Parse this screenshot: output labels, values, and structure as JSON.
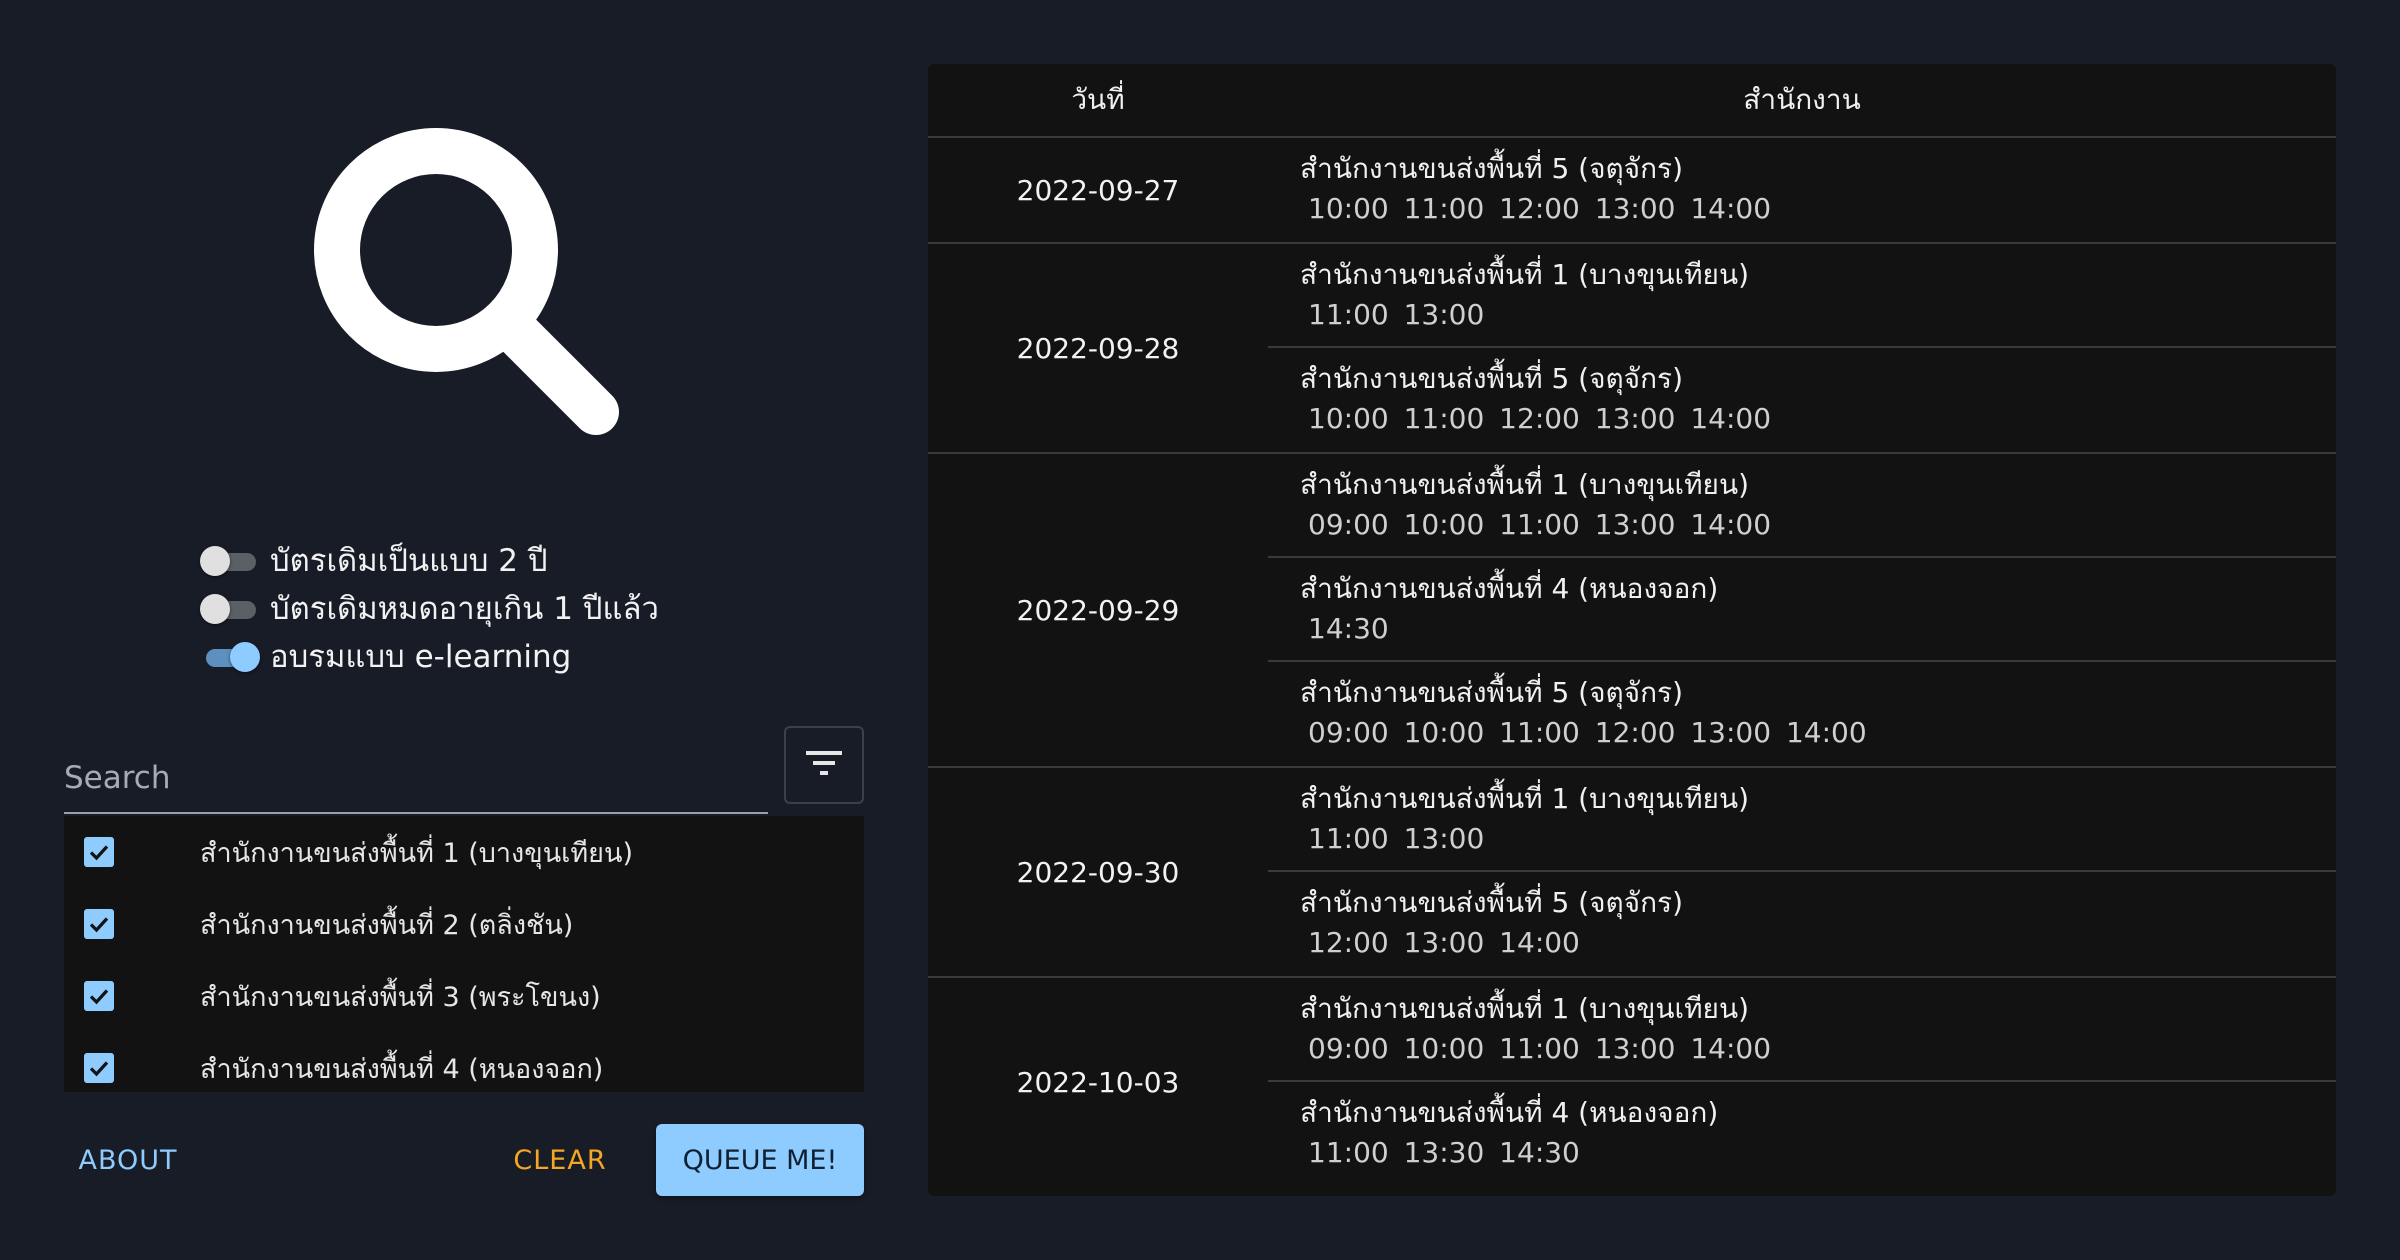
{
  "toggles": [
    {
      "label": "บัตรเดิมเป็นแบบ 2 ปี",
      "on": false
    },
    {
      "label": "บัตรเดิมหมดอายุเกิน 1 ปีแล้ว",
      "on": false
    },
    {
      "label": "อบรมแบบ e-learning",
      "on": true
    }
  ],
  "search": {
    "placeholder": "Search",
    "value": ""
  },
  "offices": [
    {
      "label": "สำนักงานขนส่งพื้นที่ 1 (บางขุนเทียน)",
      "checked": true
    },
    {
      "label": "สำนักงานขนส่งพื้นที่ 2 (ตลิ่งชัน)",
      "checked": true
    },
    {
      "label": "สำนักงานขนส่งพื้นที่ 3 (พระโขนง)",
      "checked": true
    },
    {
      "label": "สำนักงานขนส่งพื้นที่ 4 (หนองจอก)",
      "checked": true
    }
  ],
  "buttons": {
    "about": "ABOUT",
    "clear": "CLEAR",
    "queue": "QUEUE ME!"
  },
  "colors": {
    "accent": "#8ecbff",
    "clear": "#f5a623",
    "background": "#181c27",
    "panel": "#121212"
  },
  "table": {
    "headers": {
      "date": "วันที่",
      "office": "สำนักงาน"
    },
    "rows": [
      {
        "date": "2022-09-27",
        "entries": [
          {
            "office": "สำนักงานขนส่งพื้นที่ 5 (จตุจักร)",
            "times": "10:00  11:00  12:00  13:00  14:00"
          }
        ]
      },
      {
        "date": "2022-09-28",
        "entries": [
          {
            "office": "สำนักงานขนส่งพื้นที่ 1 (บางขุนเทียน)",
            "times": "11:00  13:00"
          },
          {
            "office": "สำนักงานขนส่งพื้นที่ 5 (จตุจักร)",
            "times": "10:00  11:00  12:00  13:00  14:00"
          }
        ]
      },
      {
        "date": "2022-09-29",
        "entries": [
          {
            "office": "สำนักงานขนส่งพื้นที่ 1 (บางขุนเทียน)",
            "times": "09:00  10:00  11:00  13:00  14:00"
          },
          {
            "office": "สำนักงานขนส่งพื้นที่ 4 (หนองจอก)",
            "times": "14:30"
          },
          {
            "office": "สำนักงานขนส่งพื้นที่ 5 (จตุจักร)",
            "times": "09:00  10:00  11:00  12:00  13:00  14:00"
          }
        ]
      },
      {
        "date": "2022-09-30",
        "entries": [
          {
            "office": "สำนักงานขนส่งพื้นที่ 1 (บางขุนเทียน)",
            "times": "11:00  13:00"
          },
          {
            "office": "สำนักงานขนส่งพื้นที่ 5 (จตุจักร)",
            "times": "12:00  13:00  14:00"
          }
        ]
      },
      {
        "date": "2022-10-03",
        "entries": [
          {
            "office": "สำนักงานขนส่งพื้นที่ 1 (บางขุนเทียน)",
            "times": "09:00  10:00  11:00  13:00  14:00"
          },
          {
            "office": "สำนักงานขนส่งพื้นที่ 4 (หนองจอก)",
            "times": "11:00  13:30  14:30"
          }
        ]
      }
    ]
  }
}
